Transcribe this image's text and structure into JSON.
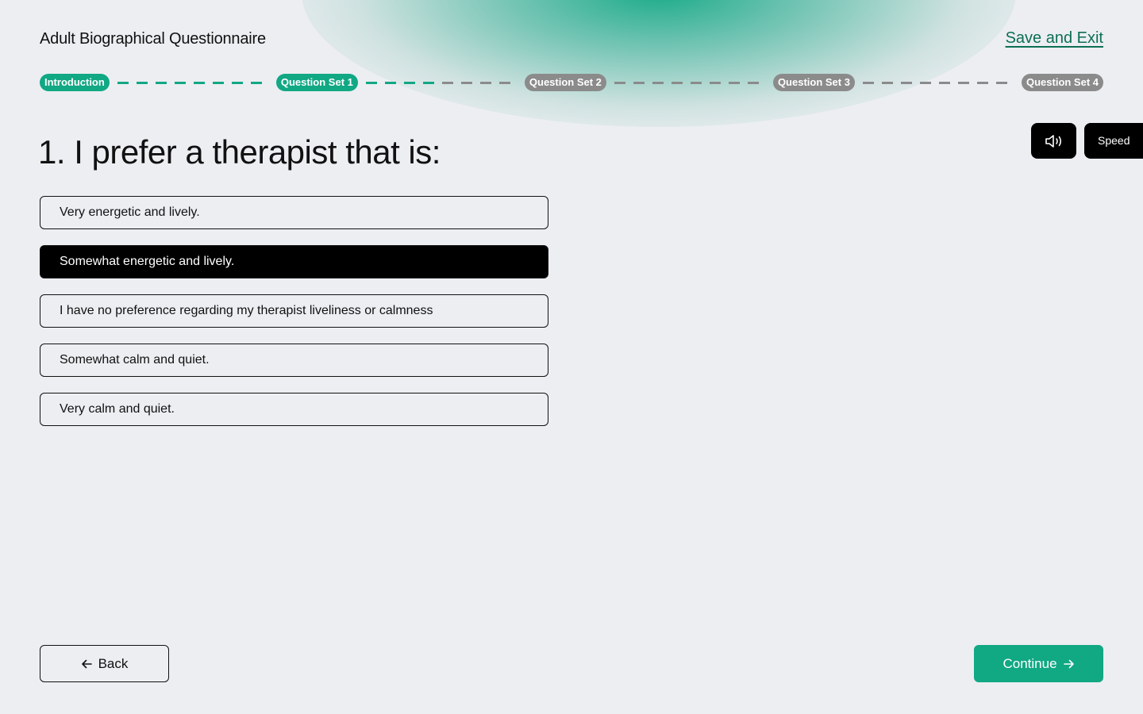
{
  "header": {
    "title": "Adult Biographical Questionnaire",
    "save_exit": "Save and Exit"
  },
  "progress": {
    "steps": [
      {
        "label": "Introduction",
        "status": "active"
      },
      {
        "label": "Question Set 1",
        "status": "active"
      },
      {
        "label": "Question Set 2",
        "status": "inactive"
      },
      {
        "label": "Question Set 3",
        "status": "inactive"
      },
      {
        "label": "Question Set 4",
        "status": "inactive"
      }
    ]
  },
  "controls": {
    "audio_icon": "speaker-icon",
    "speed_label": "Speed"
  },
  "question": {
    "text": "1. I prefer a therapist that is:",
    "options": [
      {
        "label": "Very energetic and lively.",
        "selected": false
      },
      {
        "label": "Somewhat energetic and lively.",
        "selected": true
      },
      {
        "label": "I have no preference regarding my therapist liveliness or calmness",
        "selected": false
      },
      {
        "label": "Somewhat calm and quiet.",
        "selected": false
      },
      {
        "label": "Very calm and quiet.",
        "selected": false
      }
    ]
  },
  "footer": {
    "back_label": "Back",
    "back_icon": "arrow-left-icon",
    "continue_label": "Continue",
    "continue_icon": "arrow-right-icon"
  },
  "colors": {
    "accent": "#11a884",
    "inactive": "#8b8b8b",
    "background": "#eceef2",
    "link": "#0c6f54"
  }
}
